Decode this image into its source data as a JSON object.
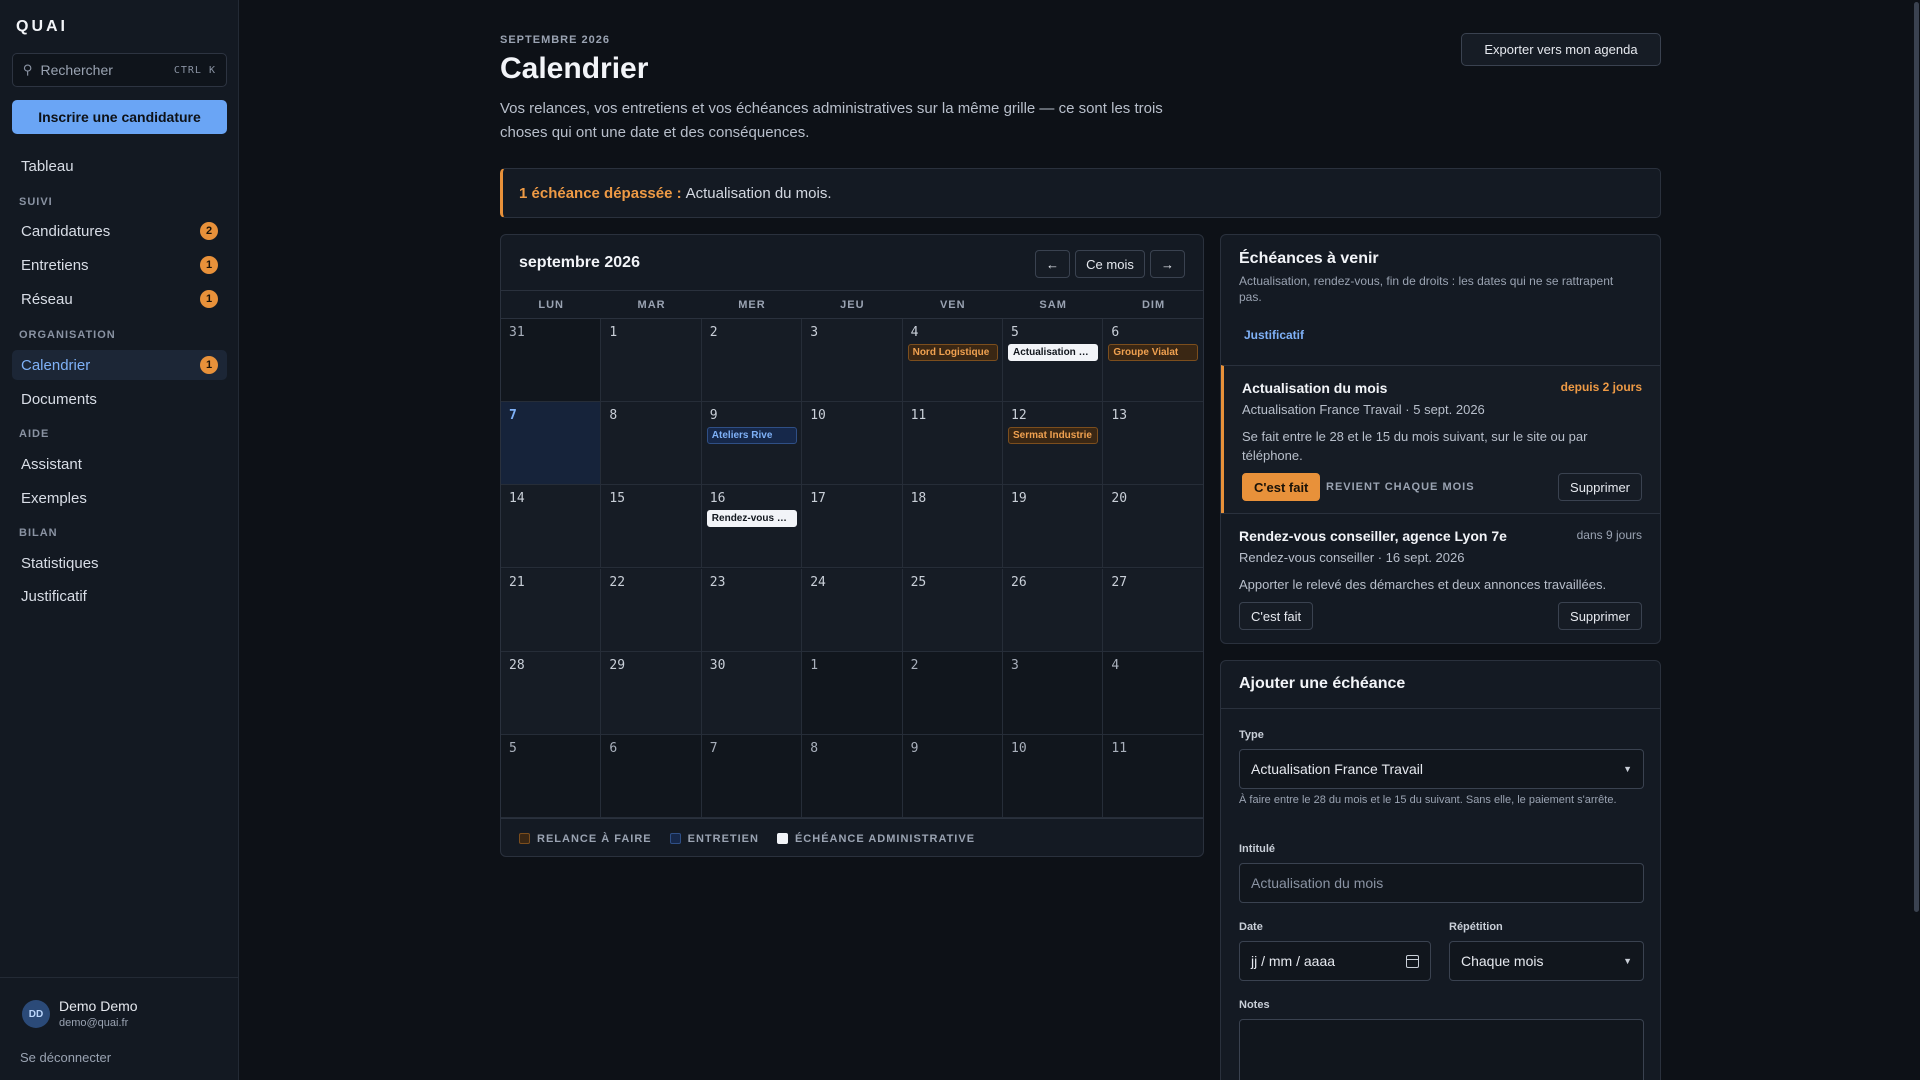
{
  "app": {
    "logo": "QUAI"
  },
  "sidebar": {
    "search_placeholder": "Rechercher",
    "search_shortcut": "CTRL K",
    "cta_label": "Inscrire une candidature",
    "top_item": "Tableau",
    "sections": {
      "suivi": "SUIVI",
      "organisation": "ORGANISATION",
      "aide": "AIDE",
      "bilan": "BILAN"
    },
    "items": {
      "candidatures": {
        "label": "Candidatures",
        "badge": "2"
      },
      "entretiens": {
        "label": "Entretiens",
        "badge": "1"
      },
      "reseau": {
        "label": "Réseau",
        "badge": "1"
      },
      "calendrier": {
        "label": "Calendrier",
        "badge": "1"
      },
      "documents": {
        "label": "Documents"
      },
      "assistant": {
        "label": "Assistant"
      },
      "exemples": {
        "label": "Exemples"
      },
      "statistiques": {
        "label": "Statistiques"
      },
      "justificatif": {
        "label": "Justificatif"
      }
    },
    "user": {
      "initials": "DD",
      "name": "Demo Demo",
      "email": "demo@quai.fr",
      "logout": "Se déconnecter"
    }
  },
  "header": {
    "eyebrow": "SEPTEMBRE 2026",
    "title": "Calendrier",
    "description": "Vos relances, vos entretiens et vos échéances administratives sur la même grille — ce sont les trois choses qui ont une date et des conséquences.",
    "export_label": "Exporter vers mon agenda"
  },
  "alert": {
    "strong": "1 échéance dépassée :",
    "text": "Actualisation du mois."
  },
  "calendar": {
    "month_label": "septembre 2026",
    "prev_label": "←",
    "today_label": "Ce mois",
    "next_label": "→",
    "weekdays": [
      "LUN",
      "MAR",
      "MER",
      "JEU",
      "VEN",
      "SAM",
      "DIM"
    ],
    "days": [
      {
        "d": "31",
        "out": true
      },
      {
        "d": "1"
      },
      {
        "d": "2"
      },
      {
        "d": "3"
      },
      {
        "d": "4",
        "event": {
          "kind": "relance",
          "label": "Nord Logistique"
        }
      },
      {
        "d": "5",
        "event": {
          "kind": "admin",
          "label": "Actualisation du mois"
        }
      },
      {
        "d": "6",
        "event": {
          "kind": "relance",
          "label": "Groupe Vialat"
        }
      },
      {
        "d": "7",
        "today": true
      },
      {
        "d": "8"
      },
      {
        "d": "9",
        "event": {
          "kind": "entretien",
          "label": "Ateliers Rive"
        }
      },
      {
        "d": "10"
      },
      {
        "d": "11"
      },
      {
        "d": "12",
        "event": {
          "kind": "relance",
          "label": "Sermat Industrie"
        }
      },
      {
        "d": "13"
      },
      {
        "d": "14"
      },
      {
        "d": "15"
      },
      {
        "d": "16",
        "event": {
          "kind": "admin",
          "label": "Rendez-vous conseiller"
        }
      },
      {
        "d": "17"
      },
      {
        "d": "18"
      },
      {
        "d": "19"
      },
      {
        "d": "20"
      },
      {
        "d": "21"
      },
      {
        "d": "22"
      },
      {
        "d": "23"
      },
      {
        "d": "24"
      },
      {
        "d": "25"
      },
      {
        "d": "26"
      },
      {
        "d": "27"
      },
      {
        "d": "28"
      },
      {
        "d": "29"
      },
      {
        "d": "30"
      },
      {
        "d": "1",
        "out": true
      },
      {
        "d": "2",
        "out": true
      },
      {
        "d": "3",
        "out": true
      },
      {
        "d": "4",
        "out": true
      },
      {
        "d": "5",
        "out": true
      },
      {
        "d": "6",
        "out": true
      },
      {
        "d": "7",
        "out": true
      },
      {
        "d": "8",
        "out": true
      },
      {
        "d": "9",
        "out": true
      },
      {
        "d": "10",
        "out": true
      },
      {
        "d": "11",
        "out": true
      }
    ],
    "legend": {
      "relance": "RELANCE À FAIRE",
      "entretien": "ENTRETIEN",
      "admin": "ÉCHÉANCE ADMINISTRATIVE"
    }
  },
  "upcoming": {
    "title": "Échéances à venir",
    "subtitle": "Actualisation, rendez-vous, fin de droits : les dates qui ne se rattrapent pas.",
    "link": "Justificatif",
    "items": [
      {
        "title": "Actualisation du mois",
        "when": "depuis 2 jours",
        "meta": "Actualisation France Travail · 5 sept. 2026",
        "desc": "Se fait entre le 28 et le 15 du mois suivant, sur le site ou par téléphone.",
        "done_label": "C'est fait",
        "recurrence": "REVIENT CHAQUE MOIS",
        "delete_label": "Supprimer"
      },
      {
        "title": "Rendez-vous conseiller, agence Lyon 7e",
        "when": "dans 9 jours",
        "meta": "Rendez-vous conseiller · 16 sept. 2026",
        "desc": "Apporter le relevé des démarches et deux annonces travaillées.",
        "done_label": "C'est fait",
        "delete_label": "Supprimer"
      }
    ]
  },
  "form": {
    "title": "Ajouter une échéance",
    "type_label": "Type",
    "type_value": "Actualisation France Travail",
    "type_hint": "À faire entre le 28 du mois et le 15 du suivant. Sans elle, le paiement s'arrête.",
    "title_label": "Intitulé",
    "title_placeholder": "Actualisation du mois",
    "date_label": "Date",
    "date_placeholder": "jj / mm / aaaa",
    "repeat_label": "Répétition",
    "repeat_value": "Chaque mois",
    "notes_label": "Notes"
  }
}
